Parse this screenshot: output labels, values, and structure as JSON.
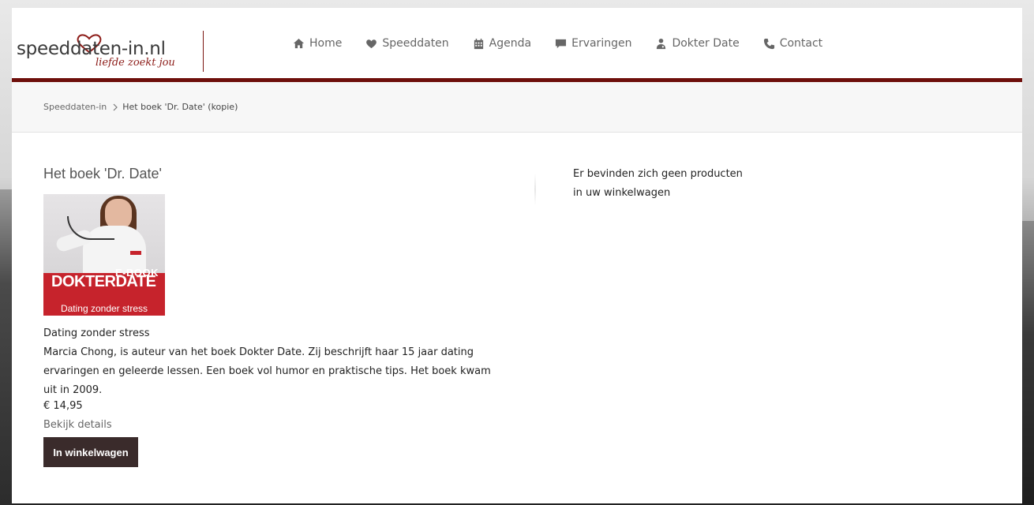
{
  "brand": {
    "logo_text": "speeddaten-in.nl",
    "tagline": "liefde zoekt jou",
    "accent": "#6e0f0b"
  },
  "nav": {
    "items": [
      {
        "label": "Home",
        "icon": "home-icon"
      },
      {
        "label": "Speeddaten",
        "icon": "heart-icon"
      },
      {
        "label": "Agenda",
        "icon": "calendar-icon"
      },
      {
        "label": "Ervaringen",
        "icon": "chat-icon"
      },
      {
        "label": "Dokter Date",
        "icon": "doctor-icon"
      },
      {
        "label": "Contact",
        "icon": "phone-icon"
      }
    ]
  },
  "breadcrumb": {
    "home": "Speeddaten-in",
    "current": "Het boek 'Dr. Date' (kopie)"
  },
  "product": {
    "title": "Het boek 'Dr. Date'",
    "cover": {
      "ebook": "E-BOOK",
      "title": "DOKTERDATE",
      "subtitle": "Dating zonder stress"
    },
    "subtitle": "Dating zonder stress",
    "description": "Marcia Chong, is auteur van het boek Dokter Date. Zij beschrijft haar 15 jaar dating ervaringen en geleerde lessen. Een boek vol humor en praktische tips. Het boek kwam uit in 2009.",
    "price": "€ 14,95",
    "details_link": "Bekijk details",
    "cart_button": "In winkelwagen"
  },
  "cart": {
    "empty_message": "Er bevinden zich geen producten in uw winkelwagen"
  }
}
